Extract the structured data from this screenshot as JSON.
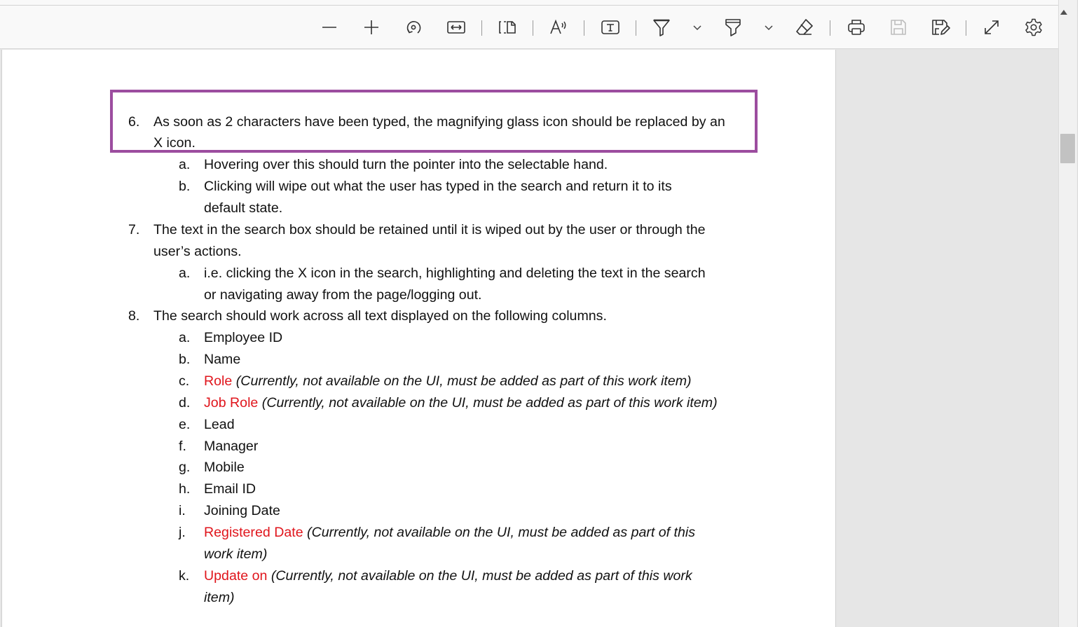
{
  "toolbar": {
    "buttons": [
      {
        "name": "zoom-out",
        "icon": "minus-icon"
      },
      {
        "name": "zoom-in",
        "icon": "plus-icon"
      },
      {
        "name": "rotate",
        "icon": "rotate-icon"
      },
      {
        "name": "fit-to-width",
        "icon": "fit-width-icon"
      },
      {
        "name": "page-view",
        "icon": "page-view-icon"
      },
      {
        "name": "read-aloud",
        "icon": "read-aloud-icon"
      },
      {
        "name": "add-text",
        "icon": "text-box-icon"
      },
      {
        "name": "draw",
        "icon": "draw-icon"
      },
      {
        "name": "highlight",
        "icon": "highlighter-icon"
      },
      {
        "name": "erase",
        "icon": "eraser-icon"
      },
      {
        "name": "print",
        "icon": "printer-icon"
      },
      {
        "name": "save",
        "icon": "save-icon"
      },
      {
        "name": "save-as",
        "icon": "save-as-icon"
      },
      {
        "name": "full-screen",
        "icon": "expand-icon"
      },
      {
        "name": "settings",
        "icon": "gear-icon"
      }
    ]
  },
  "document": {
    "item6": {
      "number": "6.",
      "line1": "As soon as 2 characters have been typed, the magnifying glass icon should be replaced by an",
      "line2": "X icon.",
      "subitems": [
        {
          "letter": "a.",
          "lines": [
            "Hovering over this should turn the pointer into the selectable hand."
          ]
        },
        {
          "letter": "b.",
          "lines": [
            "Clicking will wipe out what the user has typed in the search and return it to its",
            "default state."
          ]
        }
      ]
    },
    "item7": {
      "number": "7.",
      "line1": "The text in the search box should be retained until it is wiped out by the user or through the",
      "line2": "user’s actions.",
      "subitems": [
        {
          "letter": "a.",
          "lines": [
            "i.e. clicking the X icon in the search, highlighting and deleting the text in the search",
            "or navigating away from the page/logging out."
          ]
        }
      ]
    },
    "item8": {
      "number": "8.",
      "line1": "The search should work across all text displayed on the following columns.",
      "columns": [
        {
          "letter": "a.",
          "label": "Employee ID"
        },
        {
          "letter": "b.",
          "label": "Name"
        },
        {
          "letter": "c.",
          "label": "Role",
          "note": "(Currently, not available on the UI, must be added as part of this work item)"
        },
        {
          "letter": "d.",
          "label": "Job Role",
          "note": "(Currently, not available on the UI, must be added as part of this work item)"
        },
        {
          "letter": "e.",
          "label": "Lead"
        },
        {
          "letter": "f.",
          "label": "Manager"
        },
        {
          "letter": "g.",
          "label": "Mobile"
        },
        {
          "letter": "h.",
          "label": "Email ID"
        },
        {
          "letter": "i.",
          "label": "Joining Date"
        },
        {
          "letter": "j.",
          "label": "Registered Date",
          "note": "(Currently, not available on the UI, must be added as part of this",
          "note2": "work item)"
        },
        {
          "letter": "k.",
          "label": "Update on",
          "note": "(Currently, not available on the UI, must be added as part of this work",
          "note2": "item)"
        }
      ]
    }
  },
  "colors": {
    "highlight_border": "#9c4d9f",
    "new_column_text": "#e0151c",
    "toolbar_bg": "#f9f9f9",
    "viewer_bg": "#e6e6e6"
  }
}
